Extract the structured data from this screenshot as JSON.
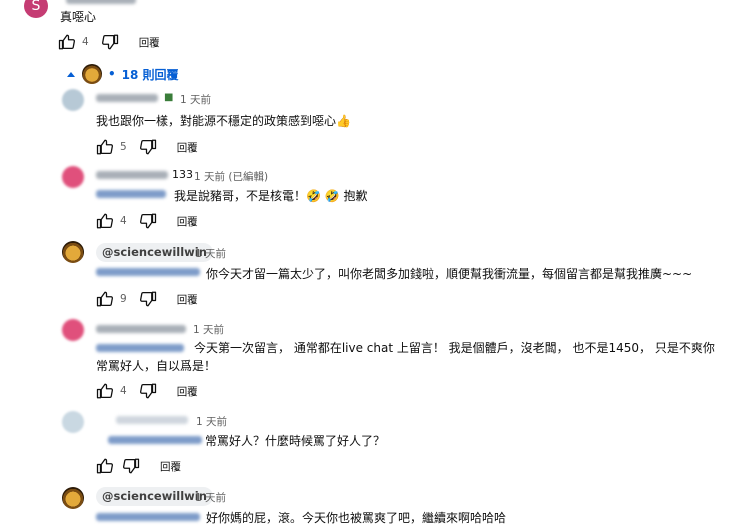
{
  "top_comment": {
    "avatar_letter": "S",
    "text": "真噁心",
    "likes": "4",
    "reply_label": "回覆"
  },
  "replies_toggle": {
    "count_label": "18 則回覆"
  },
  "replies": [
    {
      "time": "1 天前",
      "text": "我也跟你一樣，對能源不穩定的政策感到噁心👍",
      "likes": "5",
      "reply_label": "回覆"
    },
    {
      "name_suffix": "133",
      "time": "1 天前 (已編輯)",
      "text": "我是說豬哥，不是核電！🤣 🤣 抱歉",
      "likes": "4",
      "reply_label": "回覆"
    },
    {
      "handle": "@sciencewillwin",
      "time": "1 天前",
      "text": "你今天才留一篇太少了，叫你老闆多加錢啦，順便幫我衝流量，每個留言都是幫我推廣~~~",
      "likes": "9",
      "reply_label": "回覆"
    },
    {
      "time": "1 天前",
      "text": "今天第一次留言， 通常都在live chat 上留言！ 我是個體戶，沒老闆，  也不是1450，  只是不爽你常罵好人，自以爲是！",
      "likes": "4",
      "reply_label": "回覆"
    },
    {
      "time": "1 天前",
      "text": "常罵好人？什麼時候罵了好人了？",
      "reply_label": "回覆"
    },
    {
      "handle": "@sciencewillwin",
      "time": "1 天前",
      "text": "好你媽的屁，滾。今天你也被罵爽了吧，繼續來啊哈哈哈"
    }
  ]
}
